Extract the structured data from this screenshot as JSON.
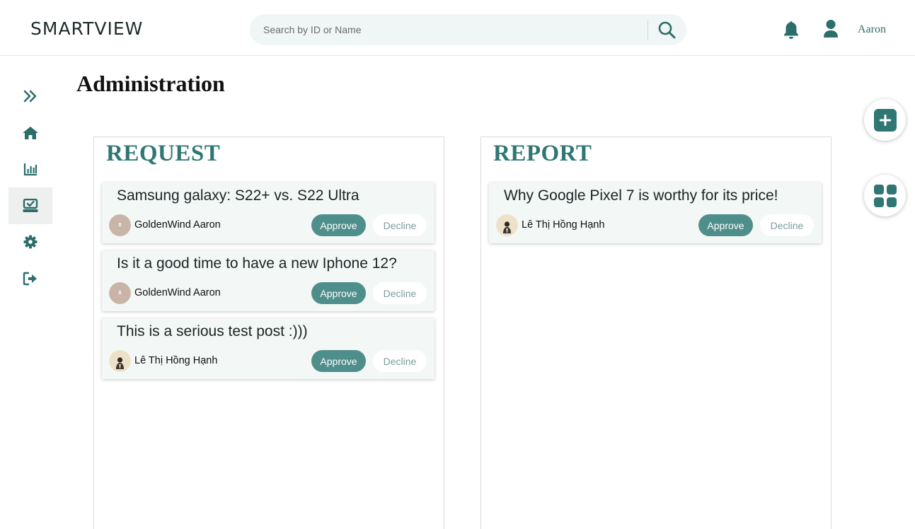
{
  "header": {
    "logo": "SMARTVIEW",
    "search_placeholder": "Search by ID or Name",
    "username": "Aaron"
  },
  "sidebar": {
    "items": [
      {
        "name": "expand",
        "icon": "double-chevron-right-icon"
      },
      {
        "name": "home",
        "icon": "home-icon"
      },
      {
        "name": "analytics",
        "icon": "bar-chart-icon"
      },
      {
        "name": "administration",
        "icon": "inbox-check-icon",
        "active": true
      },
      {
        "name": "settings",
        "icon": "gear-icon"
      },
      {
        "name": "logout",
        "icon": "logout-icon"
      }
    ]
  },
  "page": {
    "title": "Administration"
  },
  "request": {
    "title": "REQUEST",
    "items": [
      {
        "title": "Samsung galaxy: S22+ vs. S22 Ultra",
        "author": "GoldenWind Aaron",
        "approve": "Approve",
        "decline": "Decline"
      },
      {
        "title": "Is it a good time to have a new Iphone 12?",
        "author": "GoldenWind Aaron",
        "approve": "Approve",
        "decline": "Decline"
      },
      {
        "title": "This is a serious test post :)))",
        "author": "Lê Thị Hồng Hạnh",
        "approve": "Approve",
        "decline": "Decline"
      }
    ]
  },
  "report": {
    "title": "REPORT",
    "items": [
      {
        "title": "Why Google Pixel 7 is worthy for its price!",
        "author": "Lê Thị Hồng Hạnh",
        "approve": "Approve",
        "decline": "Decline"
      }
    ]
  },
  "fabs": [
    {
      "icon": "plus-icon"
    },
    {
      "icon": "grid-icon"
    }
  ],
  "colors": {
    "accent": "#2e7773",
    "approve_bg": "#4f8f8b",
    "sidebar_icon": "#2b6e6a",
    "card_bg": "#f3f7f6"
  }
}
